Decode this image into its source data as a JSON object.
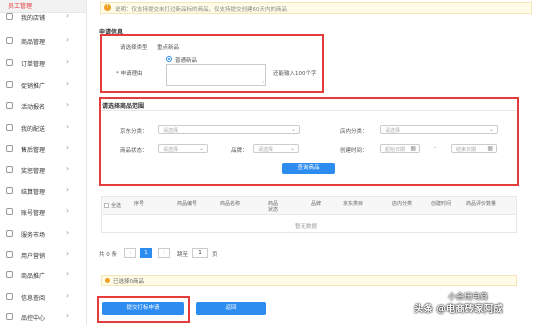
{
  "sidebar": {
    "header": "员工管理",
    "items": [
      {
        "label": "我的店铺"
      },
      {
        "label": "商品管理"
      },
      {
        "label": "订单管理"
      },
      {
        "label": "促销推广"
      },
      {
        "label": "活动报名"
      },
      {
        "label": "我的配送"
      },
      {
        "label": "售后管理"
      },
      {
        "label": "奖惩管理"
      },
      {
        "label": "结算管理"
      },
      {
        "label": "账号管理"
      },
      {
        "label": "服务市场"
      },
      {
        "label": "用户营销"
      },
      {
        "label": "商品推广"
      },
      {
        "label": "信息查阅"
      },
      {
        "label": "品控中心"
      }
    ]
  },
  "notice": {
    "icon": "!",
    "text": "说明：仅支持提交未打过新品标的商品，仅支持提交创建60天内的商品"
  },
  "apply": {
    "title": "申请信息",
    "type_label": "请选择类型",
    "type_value": "重点新品",
    "radio_label": "普通新品",
    "reason_label": "* 申请理由",
    "char_count": "还能输入100个字"
  },
  "filters": {
    "title": "请选择商品范围",
    "jd_category_label": "京东分类：",
    "jd_category_placeholder": "请选择",
    "shop_category_label": "店内分类：",
    "shop_category_placeholder": "请选择",
    "status_label": "商品状态：",
    "status_placeholder": "请选择",
    "brand_label": "品牌：",
    "brand_placeholder": "请选择",
    "created_label": "创建时间：",
    "start_date_placeholder": "起始日期",
    "date_separator": "-",
    "end_date_placeholder": "结束日期",
    "query_button": "查询商品"
  },
  "table": {
    "select_all": "全选",
    "columns": [
      "序号",
      "商品编号",
      "商品名称",
      "商品状态",
      "品牌",
      "京东类目",
      "店内分类",
      "创建时间",
      "商品评价数量"
    ],
    "empty_text": "暂无数据"
  },
  "pagination": {
    "total_text": "共 0 条",
    "prev": "‹",
    "page": "1",
    "next": "›",
    "goto_label": "跳至",
    "goto_value": "1",
    "page_unit": "页"
  },
  "selected": {
    "text": "已选择0商品"
  },
  "footer": {
    "submit_button": "提交打标申请",
    "back_button": "返回"
  },
  "watermark": {
    "text": "头条 @电商砖家阿成",
    "small_text": "小会玩电商"
  },
  "colors": {
    "accent": "#2d8cf0",
    "highlight": "#e43c3c",
    "brand": "#e4393c"
  }
}
